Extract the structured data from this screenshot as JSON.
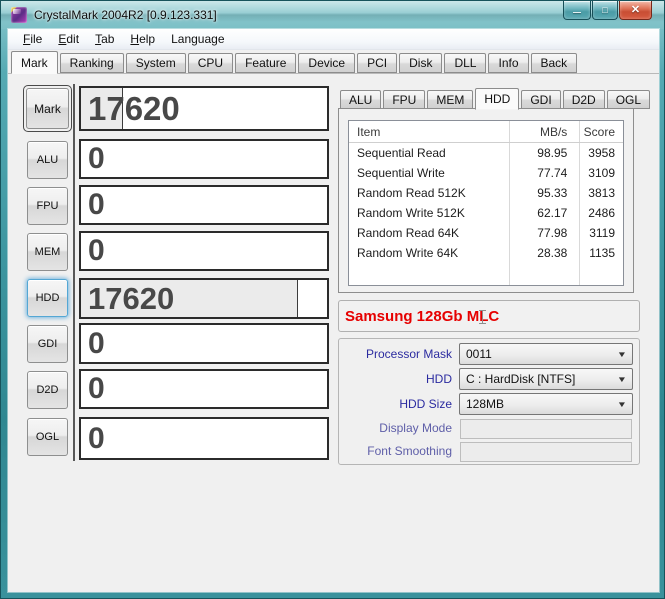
{
  "window": {
    "title": "CrystalMark 2004R2 [0.9.123.331]",
    "controls": {
      "minimize_glyph": "—",
      "maximize_glyph": "□",
      "close_glyph": "✕"
    }
  },
  "menu": {
    "items": [
      {
        "key": "F",
        "rest": "ile"
      },
      {
        "key": "E",
        "rest": "dit"
      },
      {
        "key": "T",
        "rest": "ab"
      },
      {
        "key": "H",
        "rest": "elp"
      },
      {
        "key": "",
        "rest": "Language"
      }
    ]
  },
  "main_tabs": {
    "active": "Mark",
    "items": [
      "Mark",
      "Ranking",
      "System",
      "CPU",
      "Feature",
      "Device",
      "PCI",
      "Disk",
      "DLL",
      "Info",
      "Back"
    ]
  },
  "left_panel": {
    "rows": [
      {
        "label": "Mark",
        "value": "17620"
      },
      {
        "label": "ALU",
        "value": "0"
      },
      {
        "label": "FPU",
        "value": "0"
      },
      {
        "label": "MEM",
        "value": "0"
      },
      {
        "label": "HDD",
        "value": "17620"
      },
      {
        "label": "GDI",
        "value": "0"
      },
      {
        "label": "D2D",
        "value": "0"
      },
      {
        "label": "OGL",
        "value": "0"
      }
    ]
  },
  "right_panel": {
    "tabs": {
      "active": "HDD",
      "items": [
        "ALU",
        "FPU",
        "MEM",
        "HDD",
        "GDI",
        "D2D",
        "OGL"
      ]
    },
    "table": {
      "columns": [
        "Item",
        "MB/s",
        "Score"
      ],
      "rows": [
        [
          "Sequential Read",
          "98.95",
          "3958"
        ],
        [
          "Sequential Write",
          "77.74",
          "3109"
        ],
        [
          "Random Read 512K",
          "95.33",
          "3813"
        ],
        [
          "Random Write 512K",
          "62.17",
          "2486"
        ],
        [
          "Random Read 64K",
          "77.98",
          "3119"
        ],
        [
          "Random Write 64K",
          "28.38",
          "1135"
        ]
      ]
    },
    "device_label": "Samsung 128Gb MLC",
    "form": {
      "rows": [
        {
          "label": "Processor Mask",
          "value": "0011"
        },
        {
          "label": "HDD",
          "value": "C : HardDisk [NTFS]"
        },
        {
          "label": "HDD Size",
          "value": "128MB"
        },
        {
          "label": "Display Mode",
          "value": ""
        },
        {
          "label": "Font Smoothing",
          "value": ""
        }
      ]
    }
  },
  "icons": {
    "dropdown_arrow": "▼"
  },
  "colors": {
    "titlebar_teal": "#4aa3ad",
    "close_red": "#d55a3f",
    "device_text": "#e60000",
    "label_navy": "#2b2ba0",
    "hdd_focus_blue": "#54a7d4"
  }
}
